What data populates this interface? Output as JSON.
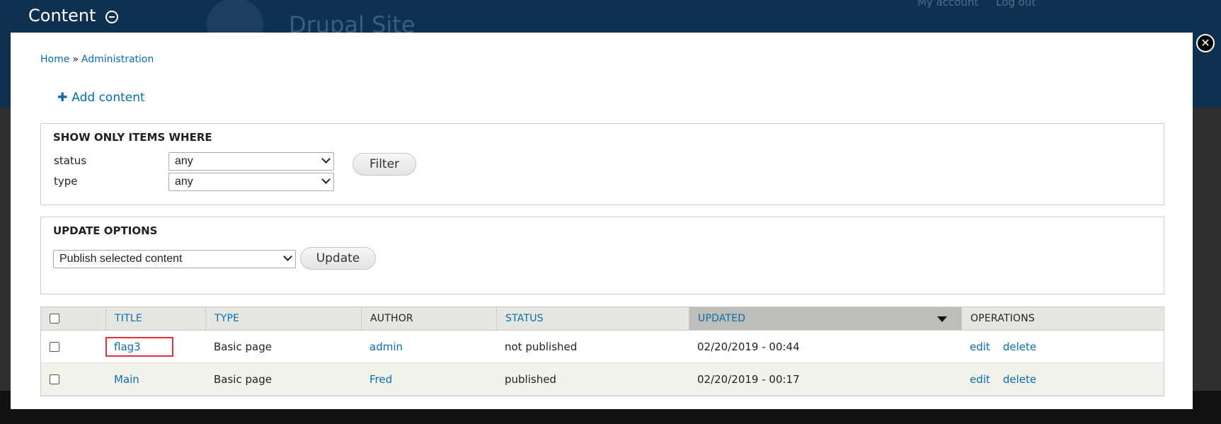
{
  "site": {
    "name": "Drupal Site",
    "user_links": [
      "My account",
      "Log out"
    ]
  },
  "overlay": {
    "title": "Content",
    "shortcut_icon": "minus-circle-icon",
    "close_icon": "close-icon",
    "close_symbol": "✕"
  },
  "breadcrumb": {
    "items": [
      "Home",
      "Administration"
    ],
    "separator": "»"
  },
  "actions": {
    "add_content_label": "Add content",
    "add_icon": "plus-icon",
    "add_symbol": "✚"
  },
  "filter": {
    "heading": "SHOW ONLY ITEMS WHERE",
    "status_label": "status",
    "status_value": "any",
    "type_label": "type",
    "type_value": "any",
    "button_label": "Filter"
  },
  "update": {
    "heading": "UPDATE OPTIONS",
    "action_value": "Publish selected content",
    "button_label": "Update"
  },
  "table": {
    "columns": [
      "TITLE",
      "TYPE",
      "AUTHOR",
      "STATUS",
      "UPDATED",
      "OPERATIONS"
    ],
    "sorted_column": "UPDATED",
    "rows": [
      {
        "title": "flag3",
        "type": "Basic page",
        "author": "admin",
        "status": "not published",
        "updated": "02/20/2019 - 00:44",
        "op_edit": "edit",
        "op_delete": "delete"
      },
      {
        "title": "Main",
        "type": "Basic page",
        "author": "Fred",
        "status": "published",
        "updated": "02/20/2019 - 00:17",
        "op_edit": "edit",
        "op_delete": "delete"
      }
    ]
  },
  "colors": {
    "link": "#0a6ea8",
    "header_bg": "#0e3150",
    "highlight": "#e0323a"
  }
}
